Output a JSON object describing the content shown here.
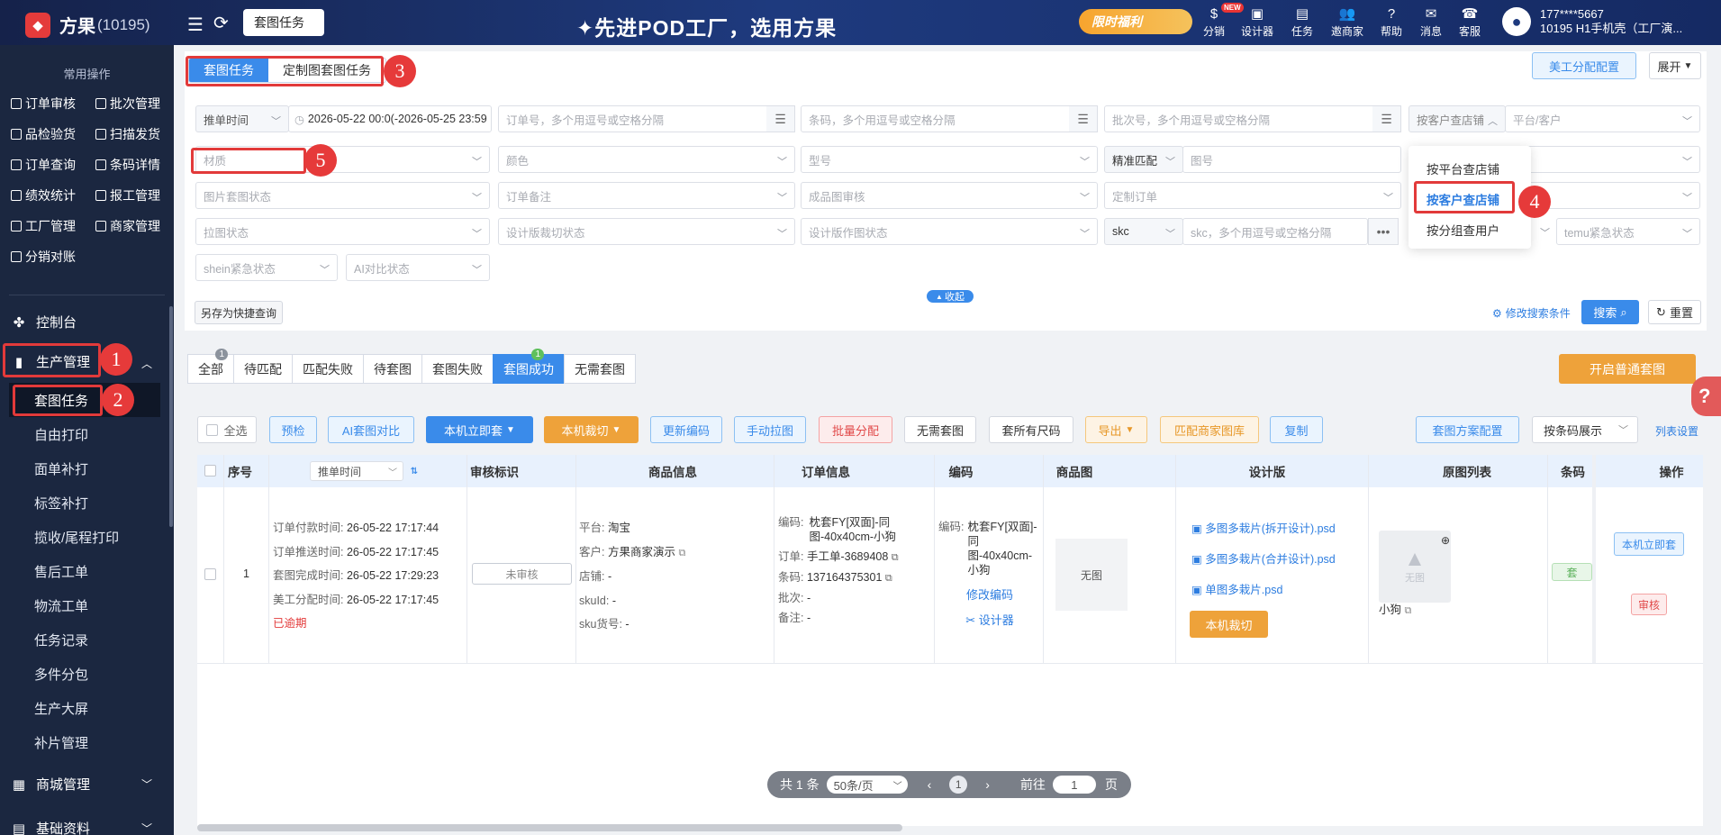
{
  "app": {
    "name": "方果",
    "id": "(10195)",
    "slogan": "✦先进POD工厂，选用方果",
    "open_tab": "套图任务",
    "promo": "限时福利"
  },
  "top_nav": [
    {
      "label": "分销",
      "icon": "distribution-icon",
      "badge": "NEW"
    },
    {
      "label": "设计器",
      "icon": "image-icon"
    },
    {
      "label": "任务",
      "icon": "task-icon"
    },
    {
      "label": "邀商家",
      "icon": "invite-icon"
    },
    {
      "label": "帮助",
      "icon": "help-icon"
    },
    {
      "label": "消息",
      "icon": "message-icon"
    },
    {
      "label": "客服",
      "icon": "service-icon"
    }
  ],
  "user": {
    "phone": "177****5667",
    "company": "10195 H1手机壳（工厂演..."
  },
  "sidebar": {
    "common_title": "常用操作",
    "quick_links": [
      "订单审核",
      "批次管理",
      "品检验货",
      "扫描发货",
      "订单查询",
      "条码详情",
      "绩效统计",
      "报工管理",
      "工厂管理",
      "商家管理",
      "分销对账"
    ],
    "console": "控制台",
    "production": "生产管理",
    "production_items": [
      "套图任务",
      "自由打印",
      "面单补打",
      "标签补打",
      "揽收/尾程打印",
      "售后工单",
      "物流工单",
      "任务记录",
      "多件分包",
      "生产大屏",
      "补片管理"
    ],
    "mall": "商城管理",
    "basic": "基础资料"
  },
  "annotations": [
    "1",
    "2",
    "3",
    "4",
    "5"
  ],
  "task_type_tabs": [
    "套图任务",
    "定制图套图任务"
  ],
  "top_right_buttons": {
    "art_config": "美工分配配置",
    "expand": "展开"
  },
  "filters": {
    "time_type": "推单时间",
    "date_range": "2026-05-22 00:0(-2026-05-25 23:59",
    "order_no_ph": "订单号，多个用逗号或空格分隔",
    "barcode_ph": "条码，多个用逗号或空格分隔",
    "batch_ph": "批次号，多个用逗号或空格分隔",
    "shop_mode": "按客户查店铺",
    "platform_ph": "平台/客户",
    "material_ph": "材质",
    "color_ph": "颜色",
    "model_ph": "型号",
    "match_mode": "精准匹配",
    "pattern_ph": "图号",
    "img_status_ph": "图片套图状态",
    "order_note_ph": "订单备注",
    "finished_review_ph": "成品图审核",
    "custom_order_ph": "定制订单",
    "pull_status_ph": "拉图状态",
    "design_cut_ph": "设计版裁切状态",
    "design_make_ph": "设计版作图状态",
    "skc": "skc",
    "skc_ph": "skc，多个用逗号或空格分隔",
    "temu_ph": "temu紧急状态",
    "shein_ph": "shein紧急状态",
    "ai_ph": "AI对比状态"
  },
  "shop_mode_options": [
    "按平台查店铺",
    "按客户查店铺",
    "按分组查用户"
  ],
  "save_quick": "另存为快捷查询",
  "collapse": "收起",
  "edit_conditions": "修改搜索条件",
  "search": "搜索",
  "reset": "重置",
  "status_tabs": [
    {
      "label": "全部",
      "badge": "1"
    },
    {
      "label": "待匹配"
    },
    {
      "label": "匹配失败"
    },
    {
      "label": "待套图"
    },
    {
      "label": "套图失败"
    },
    {
      "label": "套图成功",
      "badge": "1"
    },
    {
      "label": "无需套图"
    }
  ],
  "start_btn": "开启普通套图",
  "toolbar": {
    "select_all": "全选",
    "precheck": "预检",
    "ai": "AI套图对比",
    "local_set": "本机立即套",
    "local_cut": "本机裁切",
    "update_code": "更新编码",
    "manual_pull": "手动拉图",
    "batch_assign": "批量分配",
    "no_need": "无需套图",
    "all_sizes": "套所有尺码",
    "export": "导出",
    "match_lib": "匹配商家图库",
    "copy": "复制",
    "scheme_config": "套图方案配置",
    "barcode_display": "按条码展示",
    "col_settings": "列表设置"
  },
  "table": {
    "headers": [
      "序号",
      "推单时间",
      "审核标识",
      "商品信息",
      "订单信息",
      "编码",
      "商品图",
      "设计版",
      "原图列表",
      "条码",
      "操作"
    ],
    "row": {
      "seq": "1",
      "times": [
        [
          "订单付款时间:",
          "26-05-22 17:17:44"
        ],
        [
          "订单推送时间:",
          "26-05-22 17:17:45"
        ],
        [
          "套图完成时间:",
          "26-05-22 17:29:23"
        ],
        [
          "美工分配时间:",
          "26-05-22 17:17:45"
        ]
      ],
      "overdue": "已逾期",
      "review": "未审核",
      "goods": [
        [
          "平台:",
          "淘宝"
        ],
        [
          "客户:",
          "方果商家演示"
        ],
        [
          "店铺:",
          "-"
        ],
        [
          "skuId:",
          "-"
        ],
        [
          "sku货号:",
          "-"
        ]
      ],
      "order": {
        "code_label": "编码:",
        "code": "枕套FY[双面]-同图-40x40cm-小狗",
        "order_label": "订单:",
        "order": "手工单-3689408",
        "barcode_label": "条码:",
        "barcode": "137164375301",
        "batch_label": "批次:",
        "batch": "-",
        "note_label": "备注:",
        "note": "-"
      },
      "code": {
        "label": "编码:",
        "value": "枕套FY[双面]-同图-40x40cm-小狗",
        "modify": "修改编码",
        "designer": "设计器"
      },
      "goods_img": "无图",
      "design_files": [
        "多图多栽片(拆开设计).psd",
        "多图多栽片(合并设计).psd",
        "单图多栽片.psd"
      ],
      "local_cut": "本机裁切",
      "orig_img": "无图",
      "orig_name": "小狗",
      "barcode_tag": "套",
      "actions": [
        "本机立即套",
        "审核"
      ]
    }
  },
  "pager": {
    "total": "共 1 条",
    "per_page": "50条/页",
    "page": "1",
    "goto": "前往",
    "goto_val": "1",
    "unit": "页"
  }
}
